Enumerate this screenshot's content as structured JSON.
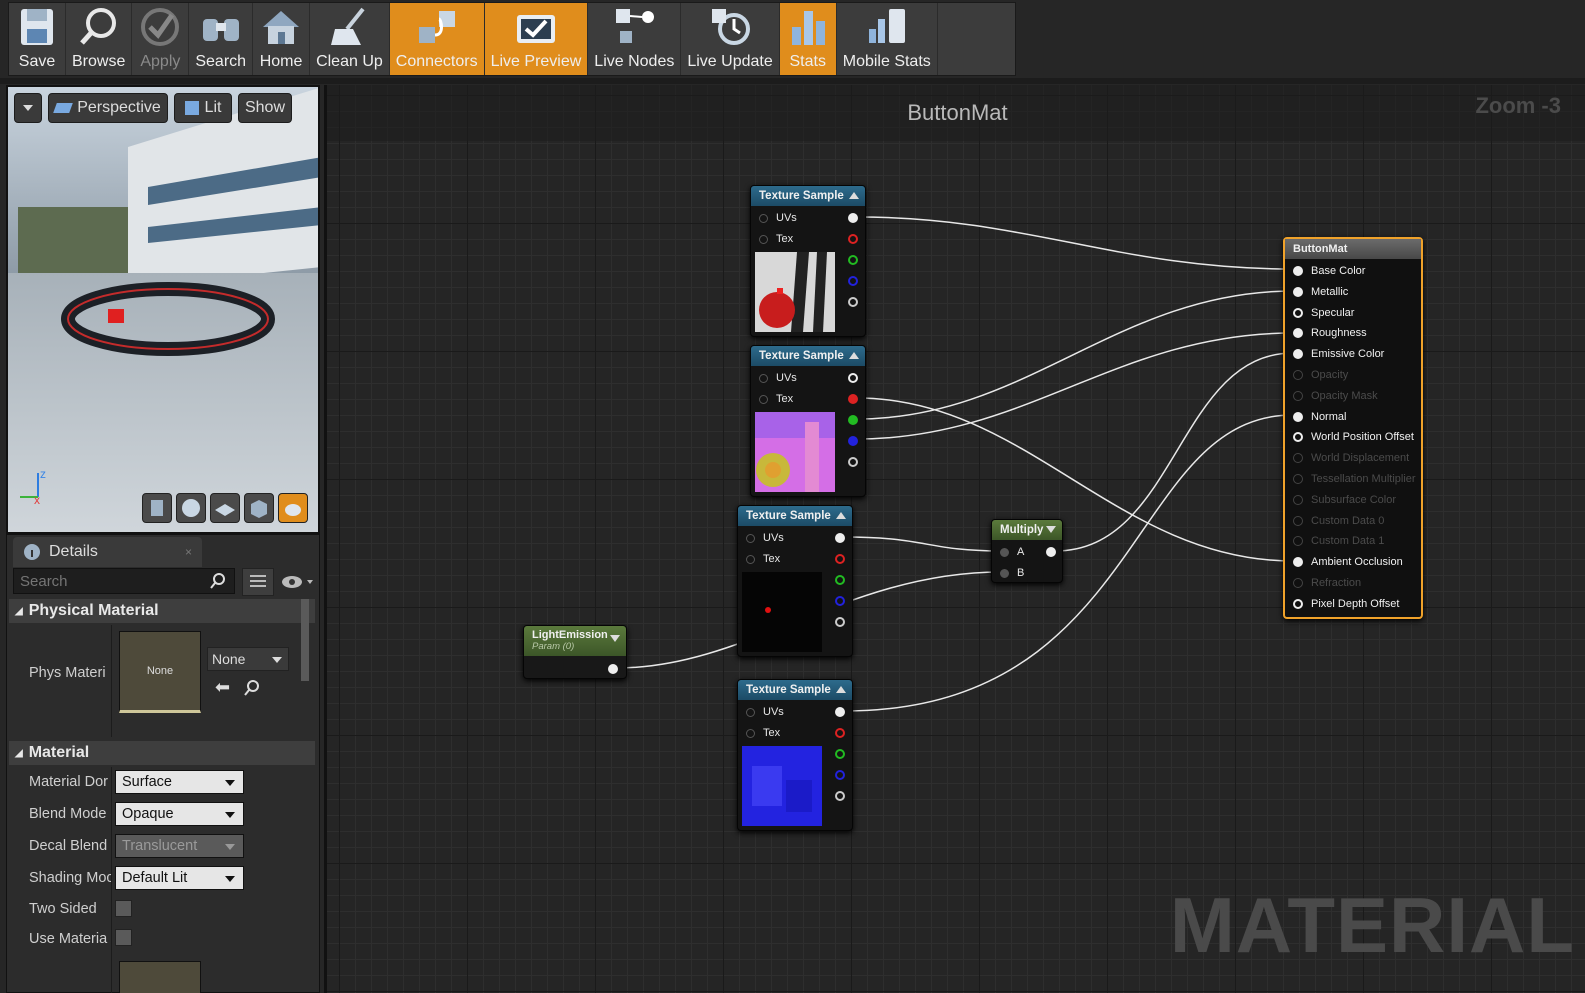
{
  "toolbar": {
    "buttons": [
      {
        "label": "Save",
        "icon": "save-icon",
        "state": "normal"
      },
      {
        "label": "Browse",
        "icon": "browse-icon",
        "state": "normal"
      },
      {
        "label": "Apply",
        "icon": "apply-check-icon",
        "state": "disabled"
      },
      {
        "label": "Search",
        "icon": "binoculars-icon",
        "state": "normal"
      },
      {
        "label": "Home",
        "icon": "home-icon",
        "state": "normal"
      },
      {
        "label": "Clean Up",
        "icon": "broom-icon",
        "state": "normal"
      },
      {
        "label": "Connectors",
        "icon": "connectors-icon",
        "state": "active"
      },
      {
        "label": "Live Preview",
        "icon": "tv-check-icon",
        "state": "active"
      },
      {
        "label": "Live Nodes",
        "icon": "live-nodes-icon",
        "state": "normal"
      },
      {
        "label": "Live Update",
        "icon": "live-update-icon",
        "state": "normal"
      },
      {
        "label": "Stats",
        "icon": "bar-chart-icon",
        "state": "active"
      },
      {
        "label": "Mobile Stats",
        "icon": "mobile-stats-icon",
        "state": "normal"
      }
    ],
    "active_color": "#e08d1c"
  },
  "viewport": {
    "perspective_label": "Perspective",
    "lit_label": "Lit",
    "show_label": "Show",
    "axis_z": "z",
    "axis_x": "x"
  },
  "details": {
    "tab_label": "Details",
    "search_placeholder": "Search",
    "physical_material_header": "Physical Material",
    "phys_material_label": "Phys Materi",
    "phys_thumb_text": "None",
    "phys_dropdown": "None",
    "material_header": "Material",
    "props": [
      {
        "label": "Material Dor",
        "value": "Surface",
        "enabled": true
      },
      {
        "label": "Blend Mode",
        "value": "Opaque",
        "enabled": true
      },
      {
        "label": "Decal Blend",
        "value": "Translucent",
        "enabled": false
      },
      {
        "label": "Shading Moc",
        "value": "Default Lit",
        "enabled": true
      }
    ],
    "two_sided_label": "Two Sided",
    "use_material_label": "Use Materia"
  },
  "graph": {
    "title": "ButtonMat",
    "zoom": "Zoom -3",
    "watermark": "MATERIAL",
    "texture_nodes": [
      {
        "title": "Texture Sample",
        "uvs": "UVs",
        "tex": "Tex",
        "texture": "stripes"
      },
      {
        "title": "Texture Sample",
        "uvs": "UVs",
        "tex": "Tex",
        "texture": "pink-normal"
      },
      {
        "title": "Texture Sample",
        "uvs": "UVs",
        "tex": "Tex",
        "texture": "black-dot"
      },
      {
        "title": "Texture Sample",
        "uvs": "UVs",
        "tex": "Tex",
        "texture": "blue-normal"
      }
    ],
    "param_node": {
      "title": "LightEmission",
      "subtitle": "Param (0)"
    },
    "multiply_node": {
      "title": "Multiply",
      "a": "A",
      "b": "B"
    },
    "material_node": {
      "title": "ButtonMat",
      "pins": [
        {
          "label": "Base Color",
          "active": true
        },
        {
          "label": "Metallic",
          "active": true
        },
        {
          "label": "Specular",
          "active": true
        },
        {
          "label": "Roughness",
          "active": true
        },
        {
          "label": "Emissive Color",
          "active": true
        },
        {
          "label": "Opacity",
          "active": false
        },
        {
          "label": "Opacity Mask",
          "active": false
        },
        {
          "label": "Normal",
          "active": true
        },
        {
          "label": "World Position Offset",
          "active": true
        },
        {
          "label": "World Displacement",
          "active": false
        },
        {
          "label": "Tessellation Multiplier",
          "active": false
        },
        {
          "label": "Subsurface Color",
          "active": false
        },
        {
          "label": "Custom Data 0",
          "active": false
        },
        {
          "label": "Custom Data 1",
          "active": false
        },
        {
          "label": "Ambient Occlusion",
          "active": true
        },
        {
          "label": "Refraction",
          "active": false
        },
        {
          "label": "Pixel Depth Offset",
          "active": true
        }
      ]
    }
  }
}
